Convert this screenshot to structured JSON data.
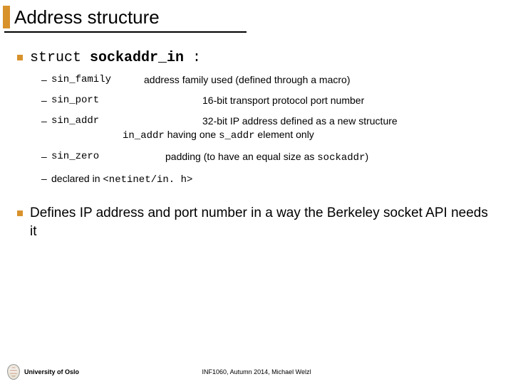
{
  "title": "Address structure",
  "struct_line": {
    "kw": "struct ",
    "name": "sockaddr_in",
    "suffix": " :"
  },
  "fields": {
    "family": {
      "name": "sin_family",
      "desc": "address family used (defined through a macro)"
    },
    "port": {
      "name": "sin_port",
      "desc": "16-bit transport protocol port number"
    },
    "addr": {
      "name": "sin_addr",
      "line1": "32-bit IP address defined as a new structure",
      "in_addr": "in_addr",
      "mid": " having one ",
      "s_addr": "s_addr",
      "end": " element only"
    },
    "zero": {
      "name": "sin_zero",
      "pre": "padding (to have an equal size as ",
      "sockaddr": "sockaddr",
      "post": ")"
    }
  },
  "declared": {
    "pre": "declared in ",
    "header": "<netinet/in. h>"
  },
  "section2": "Defines IP address and port number in a way the Berkeley socket API needs it",
  "footer": {
    "uni": "University of Oslo",
    "course": "INF1060, Autumn 2014, Michael Welzl"
  }
}
